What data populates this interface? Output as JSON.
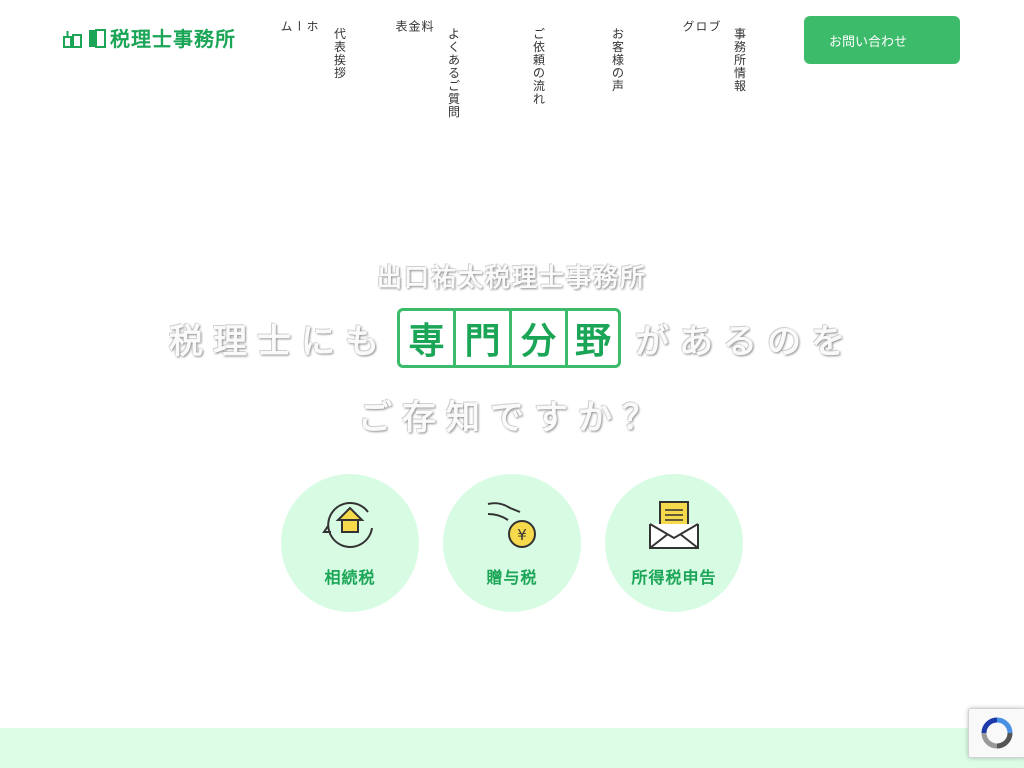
{
  "header": {
    "logo_text": "税理士事務所",
    "nav": [
      {
        "label": "ホーム",
        "vertical": true
      },
      {
        "label": "代表\n挨拶",
        "vertical": false
      },
      {
        "label": "料金表",
        "vertical": true
      },
      {
        "label": "よくある\nご質問",
        "vertical": false
      },
      {
        "label": "ご依頼\nの流れ",
        "vertical": false
      },
      {
        "label": "お客様\nの声",
        "vertical": false
      },
      {
        "label": "ブログ",
        "vertical": true
      },
      {
        "label": "事務所\n情報",
        "vertical": false
      }
    ],
    "contact_label": "お問い合わせ"
  },
  "hero": {
    "office_name": "出口祐太税理士事務所",
    "line1_prefix": "税理士にも",
    "boxed": [
      "専",
      "門",
      "分",
      "野"
    ],
    "line1_suffix": "があるのを",
    "line2": "ご存知ですか？"
  },
  "specialties": [
    {
      "label": "相続税",
      "icon": "house-cycle-icon"
    },
    {
      "label": "贈与税",
      "icon": "hand-coin-icon"
    },
    {
      "label": "所得税申告",
      "icon": "envelope-document-icon"
    }
  ],
  "colors": {
    "brand_green": "#1aa557",
    "button_green": "#3cbb6a",
    "circle_bg": "#d8fbe3",
    "icon_yellow": "#f7d94c"
  }
}
